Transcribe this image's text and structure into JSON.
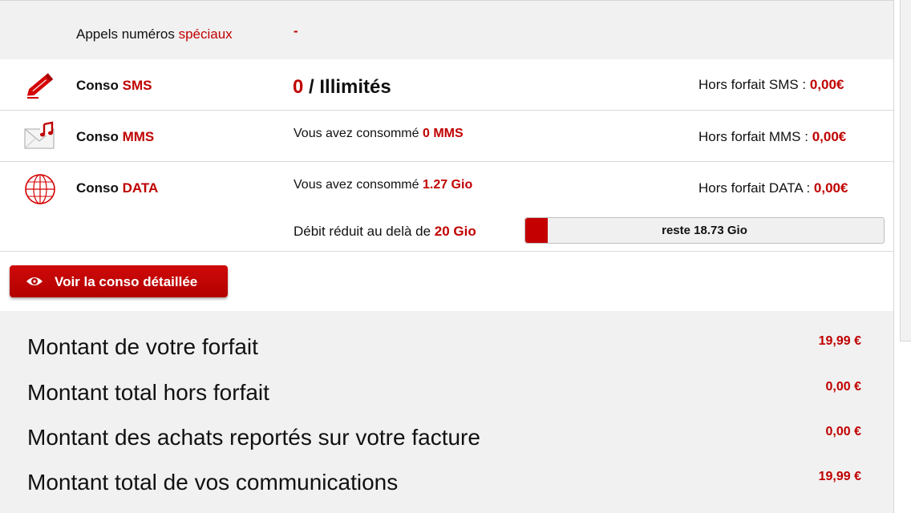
{
  "special_calls": {
    "label_prefix": "Appels numéros ",
    "label_highlight": "spéciaux",
    "value": "-"
  },
  "sms": {
    "icon": "pencil-icon",
    "label_prefix": "Conso ",
    "label_highlight": "SMS",
    "count": "0",
    "count_suffix": " / Illimités",
    "hors_label": "Hors forfait SMS : ",
    "hors_value": "0,00€"
  },
  "mms": {
    "icon": "envelope-music-icon",
    "label_prefix": "Conso ",
    "label_highlight": "MMS",
    "consumed_label": "Vous avez consommé ",
    "consumed_value": "0 MMS",
    "hors_label": "Hors forfait MMS : ",
    "hors_value": "0,00€"
  },
  "data": {
    "icon": "globe-icon",
    "label_prefix": "Conso ",
    "label_highlight": "DATA",
    "consumed_label": "Vous avez consommé ",
    "consumed_value": "1.27 Gio",
    "hors_label": "Hors forfait DATA : ",
    "hors_value": "0,00€",
    "reduced_label": "Débit réduit au delà de ",
    "reduced_value": "20 Gio",
    "remaining_label": "reste 18.73 Gio",
    "usage_fraction": 0.0635
  },
  "detail_button": {
    "icon": "eye-icon",
    "label": "Voir la conso détaillée"
  },
  "summary": [
    {
      "label": "Montant de votre forfait",
      "value": "19,99 €"
    },
    {
      "label": "Montant total hors forfait",
      "value": "0,00 €"
    },
    {
      "label": "Montant des achats reportés sur votre facture",
      "value": "0,00 €"
    },
    {
      "label": "Montant total de vos communications",
      "value": "19,99 €"
    }
  ],
  "colors": {
    "accent": "#c00000",
    "panel_bg": "#f1f1f1"
  }
}
